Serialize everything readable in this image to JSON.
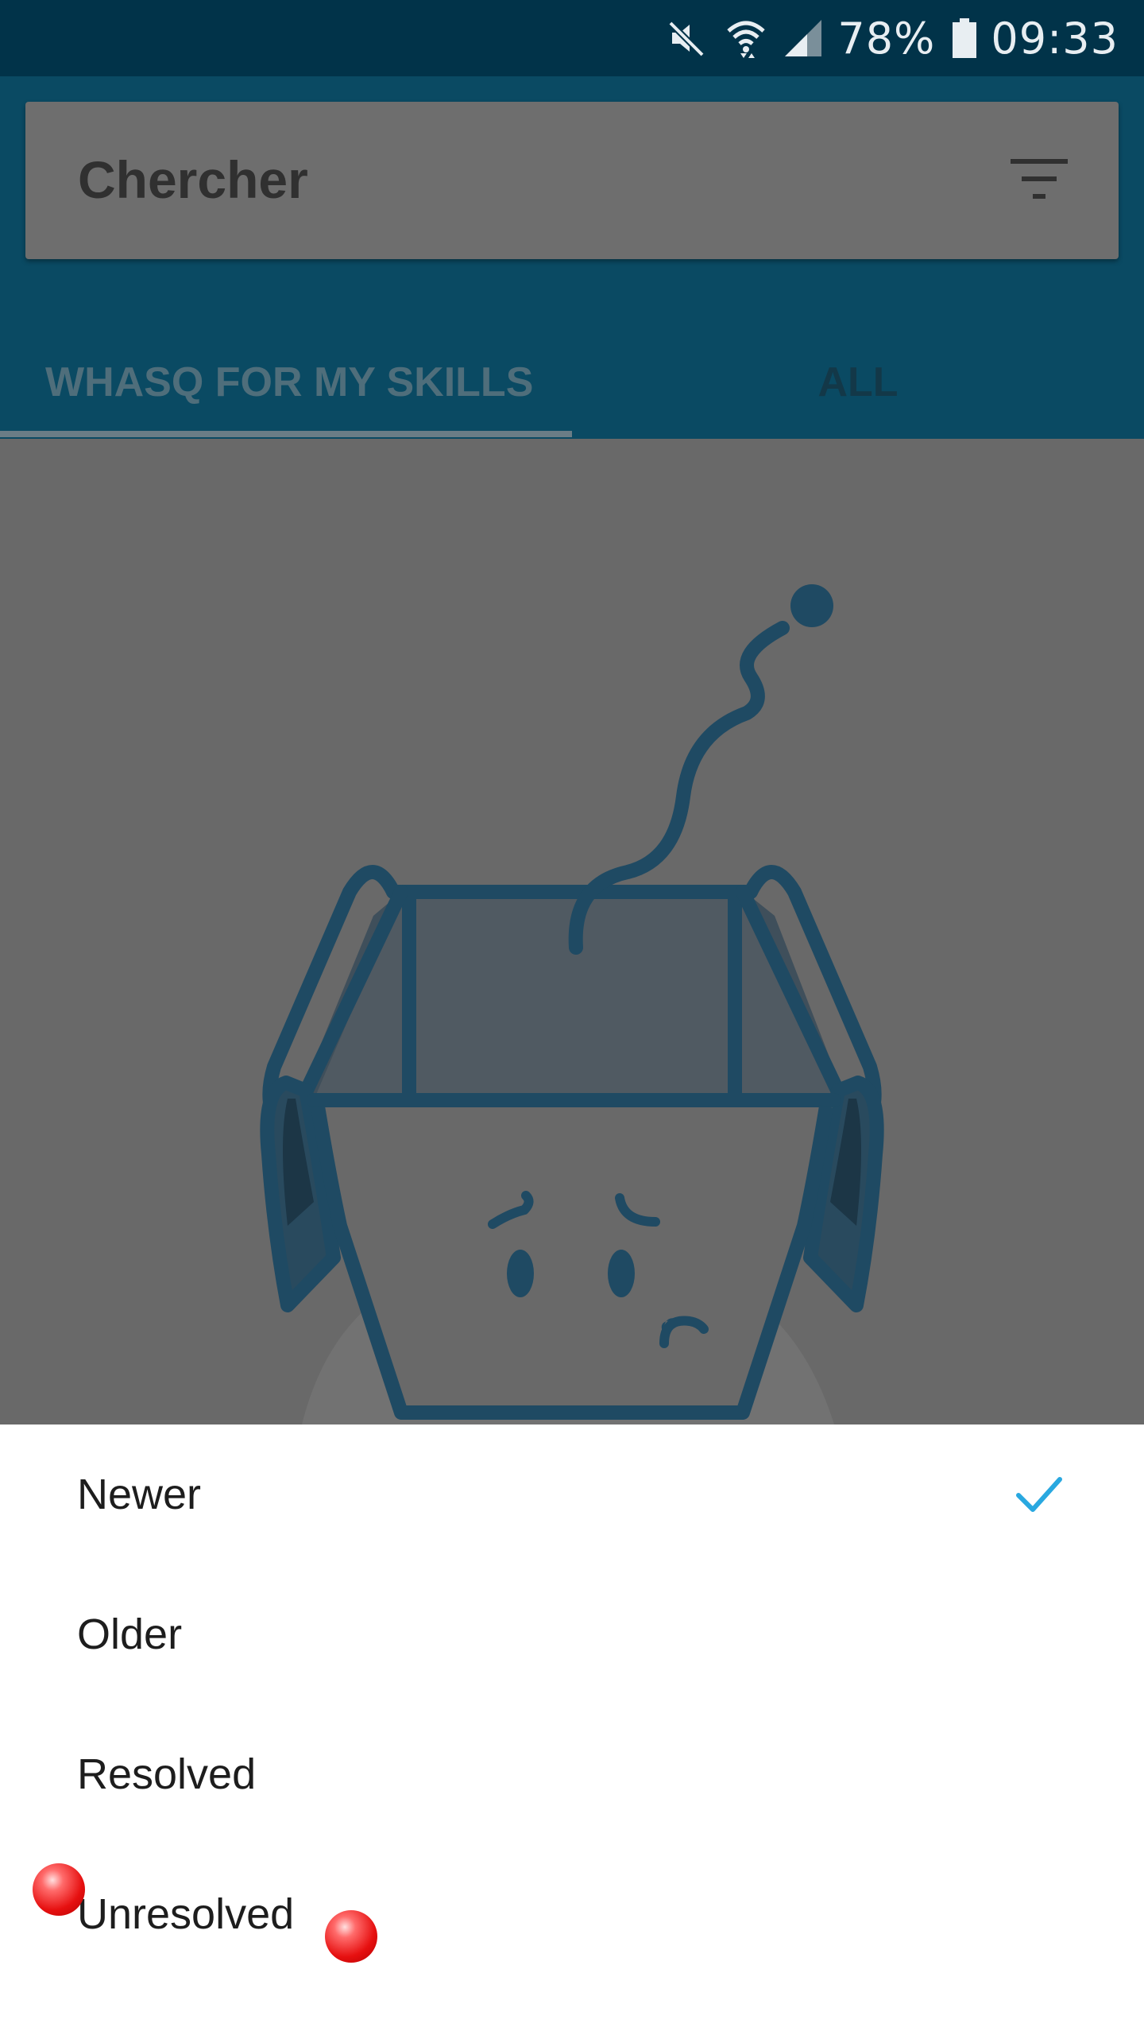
{
  "status_bar": {
    "battery": "78%",
    "time": "09:33",
    "icons": [
      "mute-icon",
      "wifi-icon",
      "signal-icon",
      "battery-icon"
    ]
  },
  "search": {
    "placeholder": "Chercher",
    "filter_icon": "filter-icon"
  },
  "tabs": [
    {
      "label": "WHASQ FOR MY SKILLS",
      "selected": true
    },
    {
      "label": "ALL",
      "selected": false
    }
  ],
  "main": {
    "illustration": "sad-empty-box-icon"
  },
  "sort_sheet": {
    "options": [
      {
        "label": "Newer",
        "checked": true
      },
      {
        "label": "Older",
        "checked": false
      },
      {
        "label": "Resolved",
        "checked": false
      },
      {
        "label": "Unresolved",
        "checked": false
      }
    ],
    "check_icon": "check-icon"
  },
  "colors": {
    "status_bar": "#013349",
    "header": "#0a4a63",
    "accent": "#29a8e0",
    "overlay_content": "#696969"
  }
}
